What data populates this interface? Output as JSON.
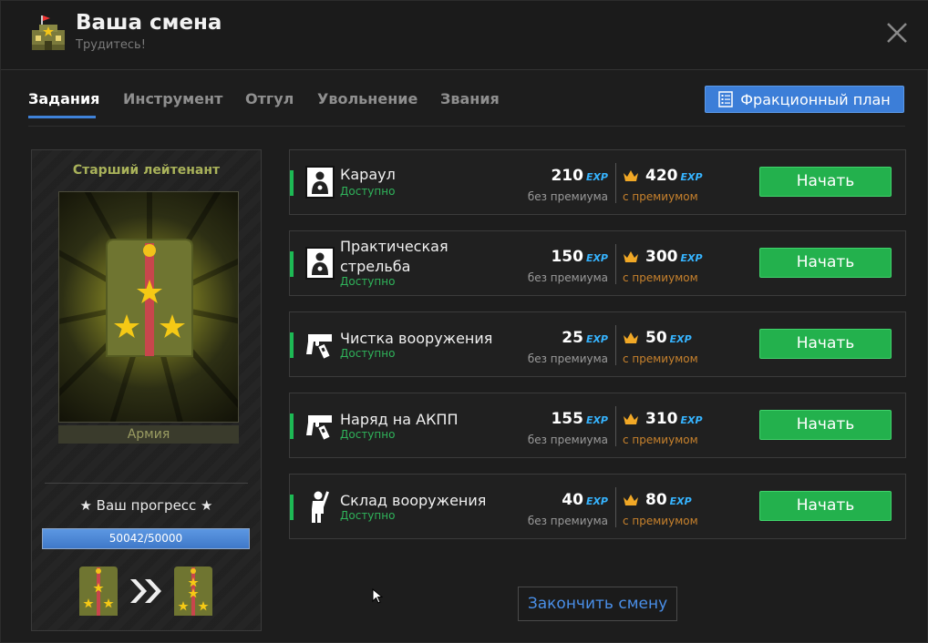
{
  "header": {
    "title": "Ваша смена",
    "subtitle": "Трудитесь!"
  },
  "tabs": [
    {
      "label": "Задания",
      "active": true
    },
    {
      "label": "Инструмент",
      "active": false
    },
    {
      "label": "Отгул",
      "active": false
    },
    {
      "label": "Увольнение",
      "active": false
    },
    {
      "label": "Звания",
      "active": false
    }
  ],
  "plan_button": {
    "label": "Фракционный план",
    "icon": "checklist-icon"
  },
  "rank": {
    "title": "Старший лейтенант",
    "branch": "Армия",
    "progress_label": "★ Ваш прогресс ★",
    "progress_text": "50042/50000",
    "progress_fraction": 1.0
  },
  "tasks": [
    {
      "name": "Караул",
      "status": "Доступно",
      "icon": "target-icon",
      "exp_base": "210",
      "exp_premium": "420",
      "button": "Начать"
    },
    {
      "name": "Практическая стрельба",
      "status": "Доступно",
      "icon": "target-icon",
      "exp_base": "150",
      "exp_premium": "300",
      "button": "Начать"
    },
    {
      "name": "Чистка вооружения",
      "status": "Доступно",
      "icon": "pistol-icon",
      "exp_base": "25",
      "exp_premium": "50",
      "button": "Начать"
    },
    {
      "name": "Наряд на АКПП",
      "status": "Доступно",
      "icon": "pistol-icon",
      "exp_base": "155",
      "exp_premium": "310",
      "button": "Начать"
    },
    {
      "name": "Склад вооружения",
      "status": "Доступно",
      "icon": "soldier-icon",
      "exp_base": "40",
      "exp_premium": "80",
      "button": "Начать"
    }
  ],
  "labels": {
    "exp": "EXP",
    "no_premium": "без премиума",
    "with_premium": "с премиумом"
  },
  "finish_button": "Закончить смену",
  "colors": {
    "accent_blue": "#3c7ed8",
    "start_green": "#23b14d",
    "status_green": "#2fb35a",
    "premium_orange": "#c8822d",
    "exp_cyan": "#36b4ff",
    "rank_gold": "#a9b25a"
  }
}
